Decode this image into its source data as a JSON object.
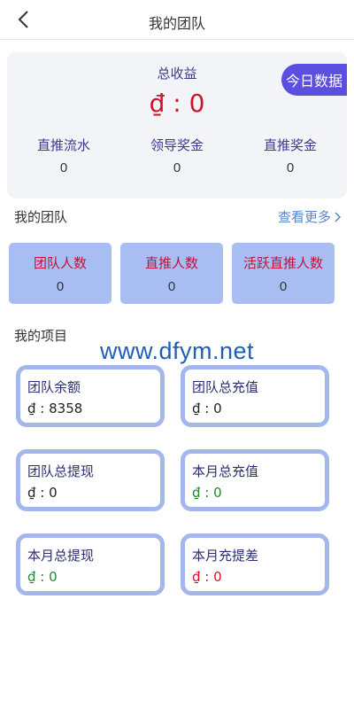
{
  "header": {
    "title": "我的团队"
  },
  "summary": {
    "today_button": "今日数据",
    "total_label": "总收益",
    "total_value": "₫ : 0",
    "stats": [
      {
        "label": "直推流水",
        "value": "0"
      },
      {
        "label": "领导奖金",
        "value": "0"
      },
      {
        "label": "直推奖金",
        "value": "0"
      }
    ]
  },
  "team_section": {
    "title": "我的团队",
    "more": "查看更多",
    "cards": [
      {
        "label": "团队人数",
        "value": "0"
      },
      {
        "label": "直推人数",
        "value": "0"
      },
      {
        "label": "活跃直推人数",
        "value": "0"
      }
    ]
  },
  "project_section": {
    "title": "我的项目",
    "cards": [
      {
        "label": "团队余额",
        "value": "₫ : 8358",
        "color": "#222222"
      },
      {
        "label": "团队总充值",
        "value": "₫ : 0",
        "color": "#222222"
      },
      {
        "label": "团队总提现",
        "value": "₫ : 0",
        "color": "#222222"
      },
      {
        "label": "本月总充值",
        "value": "₫ : 0",
        "color": "#1f8a2c"
      },
      {
        "label": "本月总提现",
        "value": "₫ : 0",
        "color": "#1f8a2c"
      },
      {
        "label": "本月充提差",
        "value": "₫ : 0",
        "color": "#d0112b"
      }
    ]
  },
  "watermark": "www.dfym.net",
  "icons": {
    "back": "chevron-left-icon",
    "more": "chevron-right-icon"
  }
}
